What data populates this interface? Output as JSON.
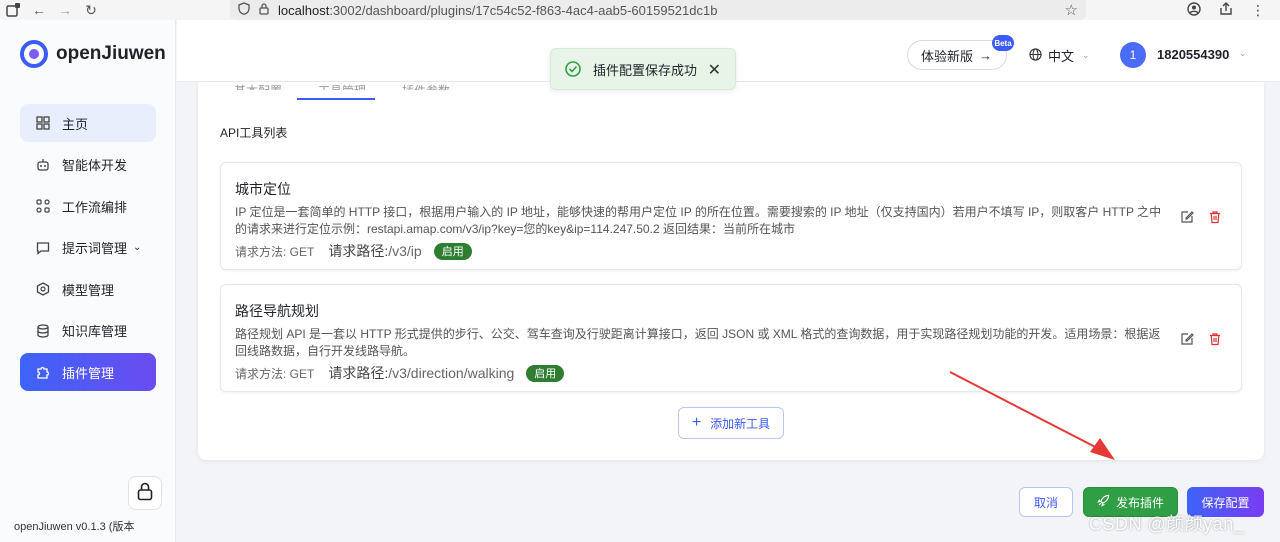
{
  "browser": {
    "url_host": "localhost",
    "url_rest": ":3002/dashboard/plugins/17c54c52-f863-4ac4-aab5-60159521dc1b"
  },
  "sidebar": {
    "logo_text": "openJiuwen",
    "items": [
      {
        "label": "主页",
        "icon": "grid-icon"
      },
      {
        "label": "智能体开发",
        "icon": "robot-icon"
      },
      {
        "label": "工作流编排",
        "icon": "workflow-icon"
      },
      {
        "label": "提示词管理",
        "icon": "chat-icon"
      },
      {
        "label": "模型管理",
        "icon": "model-icon"
      },
      {
        "label": "知识库管理",
        "icon": "database-icon"
      },
      {
        "label": "插件管理",
        "icon": "plugin-icon"
      }
    ],
    "version": "openJiuwen v0.1.3 (版本"
  },
  "header": {
    "beta_button": "体验新版",
    "beta_badge": "Beta",
    "language": "中文",
    "avatar_initial": "1",
    "username": "1820554390"
  },
  "toast": {
    "message": "插件配置保存成功"
  },
  "panel": {
    "tabs": [
      "基本配置",
      "工具管理",
      "插件参数"
    ],
    "section_title": "API工具列表",
    "tools": [
      {
        "name": "城市定位",
        "description": "IP 定位是一套简单的 HTTP 接口，根据用户输入的 IP 地址，能够快速的帮用户定位 IP 的所在位置。需要搜索的 IP 地址（仅支持国内）若用户不填写 IP，则取客户 HTTP 之中的请求来进行定位示例：restapi.amap.com/v3/ip?key=您的key&ip=114.247.50.2 返回结果：当前所在城市",
        "method_label": "请求方法: GET",
        "path_label": "请求路径: ",
        "path_value": "/v3/ip",
        "status": "启用"
      },
      {
        "name": "路径导航规划",
        "description": "路径规划 API 是一套以 HTTP 形式提供的步行、公交、驾车查询及行驶距离计算接口，返回 JSON 或 XML 格式的查询数据，用于实现路径规划功能的开发。适用场景：根据返回线路数据，自行开发线路导航。",
        "method_label": "请求方法: GET",
        "path_label": "请求路径: ",
        "path_value": "/v3/direction/walking",
        "status": "启用"
      }
    ],
    "add_tool_label": "添加新工具"
  },
  "footer": {
    "cancel_label": "取消",
    "publish_label": "发布插件",
    "save_label": "保存配置"
  },
  "watermark": "CSDN @颜颜yan_",
  "colors": {
    "accent": "#3b5bfa",
    "success": "#2f9e44",
    "status_tag": "#2e7d32",
    "danger": "#e03131",
    "annotation": "#e53935"
  }
}
